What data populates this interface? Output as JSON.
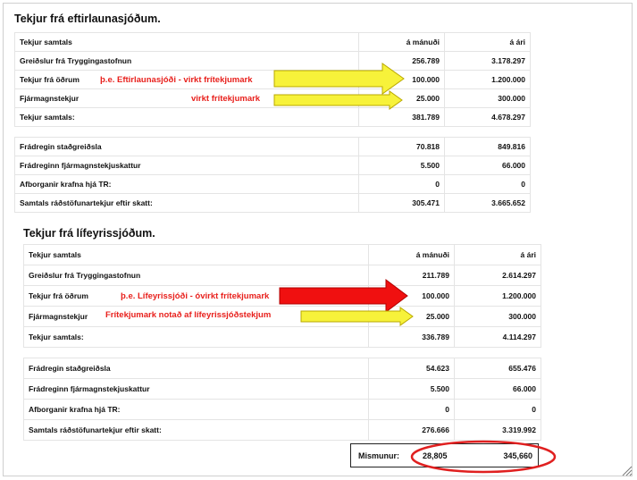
{
  "section1": {
    "title": "Tekjur frá eftirlaunasjóðum.",
    "header": {
      "label": "Tekjur samtals",
      "monthly": "á mánuði",
      "yearly": "á ári"
    },
    "income_rows": [
      {
        "label": "Greiðslur frá Tryggingastofnun",
        "monthly": "256.789",
        "yearly": "3.178.297"
      },
      {
        "label": "Tekjur frá öðrum",
        "monthly": "100.000",
        "yearly": "1.200.000"
      },
      {
        "label": "Fjármagnstekjur",
        "monthly": "25.000",
        "yearly": "300.000"
      },
      {
        "label": "Tekjur samtals:",
        "monthly": "381.789",
        "yearly": "4.678.297"
      }
    ],
    "deduction_rows": [
      {
        "label": "Frádregin staðgreiðsla",
        "monthly": "70.818",
        "yearly": "849.816"
      },
      {
        "label": "Frádreginn fjármagnstekjuskattur",
        "monthly": "5.500",
        "yearly": "66.000"
      },
      {
        "label": "Afborganir krafna hjá TR:",
        "monthly": "0",
        "yearly": "0"
      },
      {
        "label": "Samtals ráðstöfunartekjur eftir skatt:",
        "monthly": "305.471",
        "yearly": "3.665.652"
      }
    ],
    "annotations": {
      "other_income": "þ.e. Eftirlaunasjóði - virkt frítekjumark",
      "capital_income": "virkt frítekjumark"
    }
  },
  "section2": {
    "title": "Tekjur frá lífeyrissjóðum.",
    "header": {
      "label": "Tekjur samtals",
      "monthly": "á mánuði",
      "yearly": "á ári"
    },
    "income_rows": [
      {
        "label": "Greiðslur frá Tryggingastofnun",
        "monthly": "211.789",
        "yearly": "2.614.297"
      },
      {
        "label": "Tekjur frá öðrum",
        "monthly": "100.000",
        "yearly": "1.200.000"
      },
      {
        "label": "Fjármagnstekjur",
        "monthly": "25.000",
        "yearly": "300.000"
      },
      {
        "label": "Tekjur samtals:",
        "monthly": "336.789",
        "yearly": "4.114.297"
      }
    ],
    "deduction_rows": [
      {
        "label": "Frádregin staðgreiðsla",
        "monthly": "54.623",
        "yearly": "655.476"
      },
      {
        "label": "Frádreginn fjármagnstekjuskattur",
        "monthly": "5.500",
        "yearly": "66.000"
      },
      {
        "label": "Afborganir krafna hjá TR:",
        "monthly": "0",
        "yearly": "0"
      },
      {
        "label": "Samtals ráðstöfunartekjur eftir skatt:",
        "monthly": "276.666",
        "yearly": "3.319.992"
      }
    ],
    "annotations": {
      "other_income": "þ.e. Lífeyrissjóði - óvirkt frítekjumark",
      "capital_income": "Frítekjumark notað af lífeyrissjóðstekjum"
    }
  },
  "difference": {
    "label": "Mismunur:",
    "monthly": "28,805",
    "yearly": "345,660"
  },
  "colors": {
    "annotation_text": "#e8201c",
    "arrow_yellow": "#f7f23a",
    "arrow_red": "#f01010",
    "ellipse": "#e02020"
  }
}
